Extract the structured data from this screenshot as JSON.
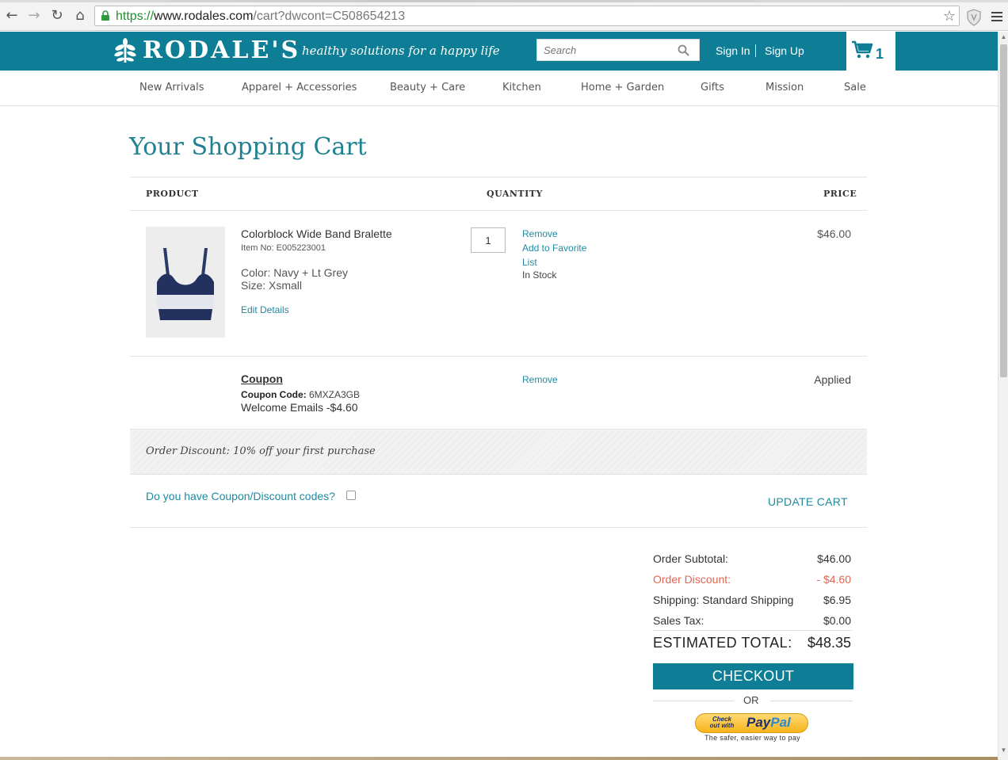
{
  "browser": {
    "url_proto": "https://",
    "url_host": "www.rodales.com",
    "url_path": "/cart?dwcont=C508654213"
  },
  "header": {
    "logo": "RODALE'S",
    "tagline": "healthy solutions for a happy life",
    "search_placeholder": "Search",
    "sign_in": "Sign In",
    "sign_up": "Sign Up",
    "cart_count": "1",
    "brand_color": "#0d7e95"
  },
  "nav": {
    "items": [
      "New Arrivals",
      "Apparel + Accessories",
      "Beauty + Care",
      "Kitchen",
      "Home + Garden",
      "Gifts",
      "Mission",
      "Sale"
    ]
  },
  "cart": {
    "title": "Your Shopping Cart",
    "columns": {
      "product": "PRODUCT",
      "quantity": "QUANTITY",
      "price": "PRICE"
    },
    "item": {
      "name": "Colorblock Wide Band Bralette",
      "item_no": "Item No: E005223001",
      "color": "Color: Navy + Lt Grey",
      "size": "Size: Xsmall",
      "edit": "Edit Details",
      "quantity": "1",
      "remove": "Remove",
      "favorite_line1": "Add to Favorite",
      "favorite_line2": "List",
      "stock": "In Stock",
      "price": "$46.00"
    },
    "coupon": {
      "title": "Coupon",
      "code_label": "Coupon Code:",
      "code": "6MXZA3GB",
      "description": "Welcome Emails -$4.60",
      "remove": "Remove",
      "status": "Applied"
    },
    "order_discount": "Order Discount: 10% off your first purchase",
    "coupon_question": "Do you have Coupon/Discount codes?",
    "update_cart": "UPDATE CART"
  },
  "summary": {
    "subtotal_label": "Order Subtotal:",
    "subtotal": "$46.00",
    "discount_label": "Order Discount:",
    "discount": "- $4.60",
    "shipping_label": "Shipping: Standard Shipping",
    "shipping": "$6.95",
    "tax_label": "Sales Tax:",
    "tax": "$0.00",
    "total_label": "ESTIMATED TOTAL:",
    "total": "$48.35",
    "checkout": "CHECKOUT",
    "or": "OR",
    "paypal_small": "Check out with",
    "paypal_word_a": "Pay",
    "paypal_word_b": "Pal",
    "paypal_tagline": "The safer, easier way to pay"
  }
}
